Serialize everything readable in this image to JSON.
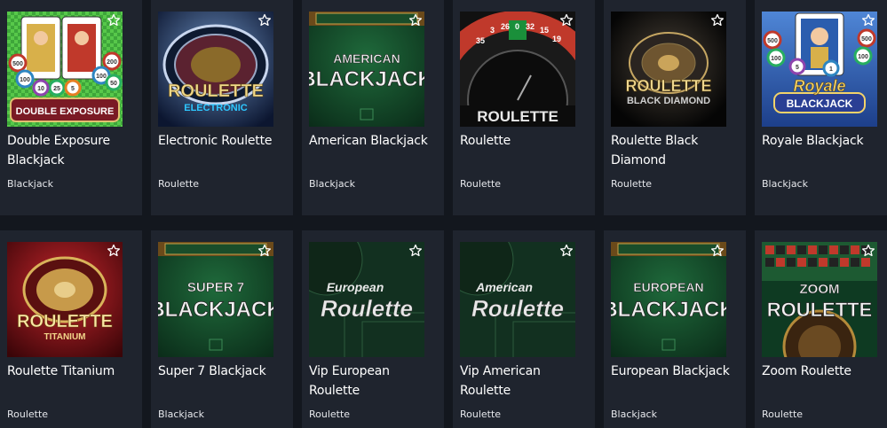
{
  "games": [
    {
      "title": "Double Exposure Blackjack",
      "category": "Blackjack",
      "art_text": [
        "DOUBLE EXPOSURE"
      ],
      "chip_values": [
        "500",
        "100",
        "25",
        "10",
        "5",
        "200",
        "100",
        "50"
      ]
    },
    {
      "title": "Electronic Roulette",
      "category": "Roulette",
      "art_text": [
        "ROULETTE",
        "ELECTRONIC"
      ]
    },
    {
      "title": "American Blackjack",
      "category": "Blackjack",
      "art_text": [
        "AMERICAN",
        "BLACKJACK"
      ]
    },
    {
      "title": "Roulette",
      "category": "Roulette",
      "art_text": [
        "ROULETTE"
      ],
      "wheel_numbers": [
        "35",
        "3",
        "26",
        "0",
        "32",
        "15",
        "19"
      ]
    },
    {
      "title": "Roulette Black Diamond",
      "category": "Roulette",
      "art_text": [
        "ROULETTE",
        "BLACK DIAMOND"
      ]
    },
    {
      "title": "Royale Blackjack",
      "category": "Blackjack",
      "art_text": [
        "Royale",
        "BLACKJACK"
      ],
      "chip_values": [
        "500",
        "100",
        "5",
        "1",
        "500",
        "100"
      ]
    },
    {
      "title": "Roulette Titanium",
      "category": "Roulette",
      "art_text": [
        "ROULETTE",
        "TITANIUM"
      ]
    },
    {
      "title": "Super 7 Blackjack",
      "category": "Blackjack",
      "art_text": [
        "SUPER 7",
        "BLACKJACK"
      ]
    },
    {
      "title": "Vip European Roulette",
      "category": "Roulette",
      "art_text": [
        "European",
        "Roulette"
      ]
    },
    {
      "title": "Vip American Roulette",
      "category": "Roulette",
      "art_text": [
        "American",
        "Roulette"
      ]
    },
    {
      "title": "European Blackjack",
      "category": "Blackjack",
      "art_text": [
        "EUROPEAN",
        "BLACKJACK"
      ]
    },
    {
      "title": "Zoom Roulette",
      "category": "Roulette",
      "art_text": [
        "ZOOM",
        "ROULETTE"
      ]
    }
  ],
  "icons": {
    "favorite": "star-outline-icon"
  },
  "colors": {
    "page_bg": "#13171e",
    "card_bg": "#1f242e",
    "title": "#ffffff",
    "category": "#e6e8ec"
  }
}
